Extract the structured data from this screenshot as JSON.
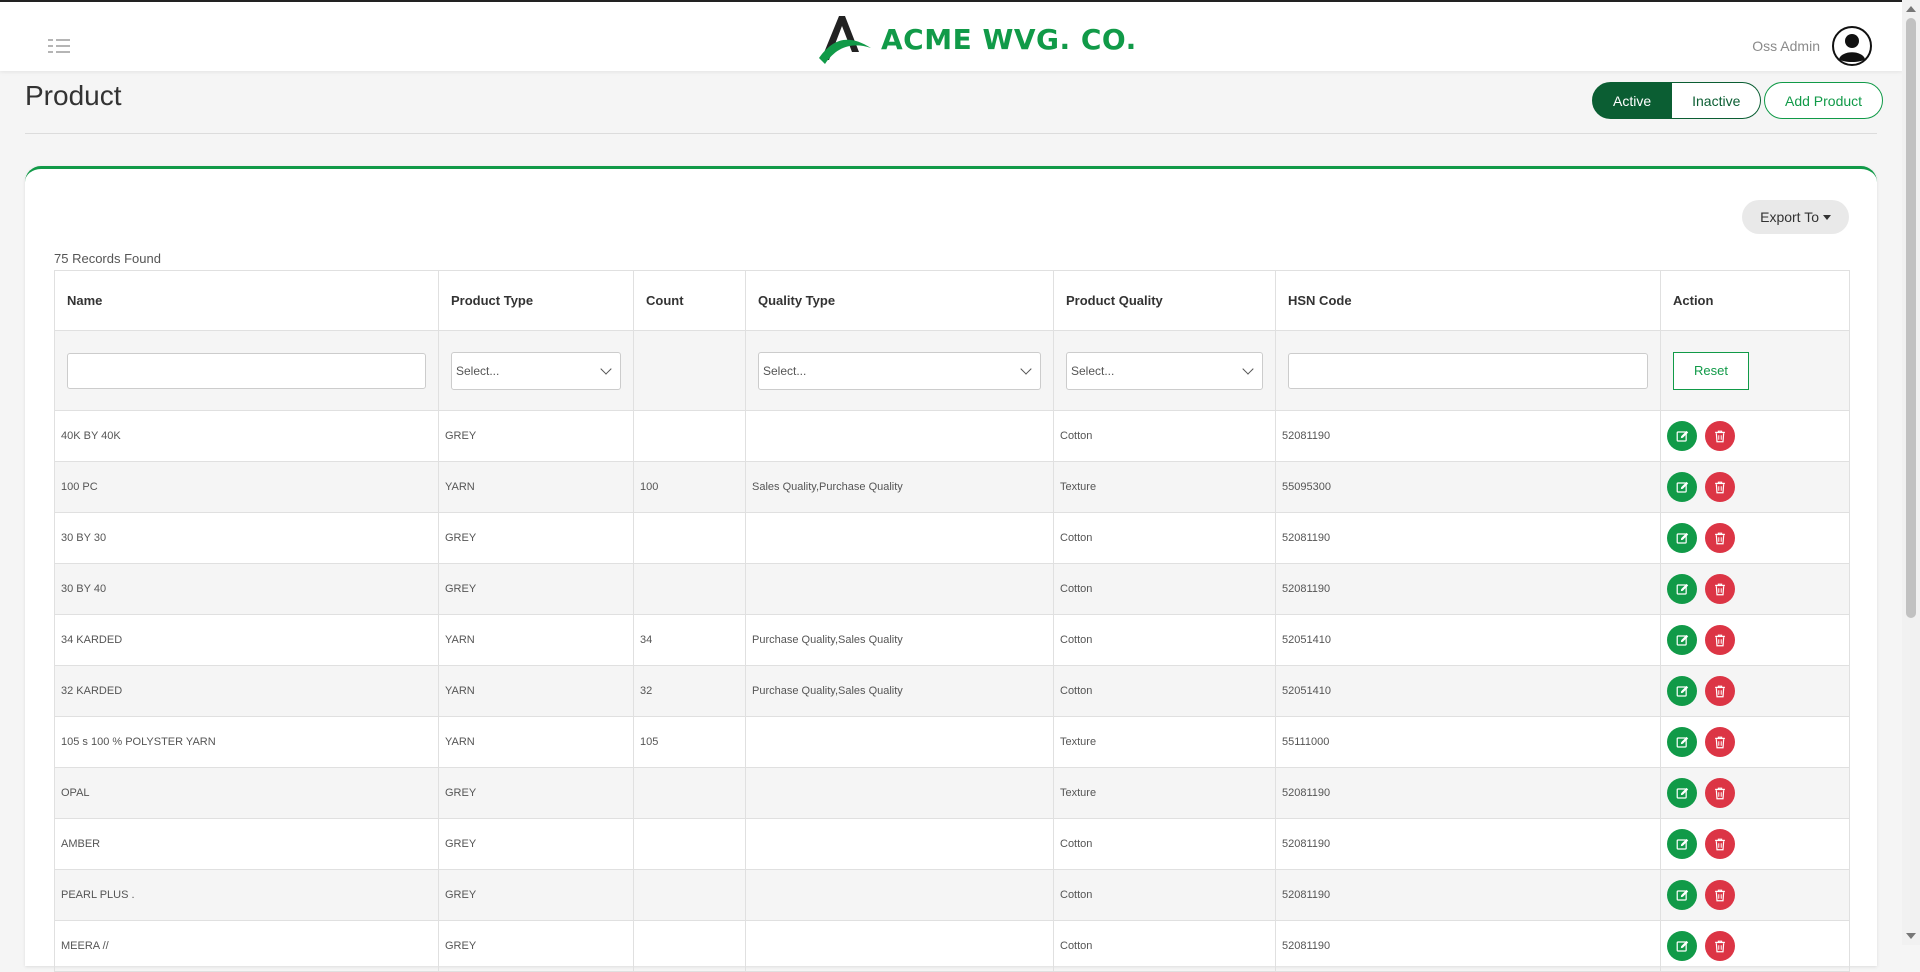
{
  "header": {
    "brand_name": "ACME WVG. CO.",
    "user_name": "Oss Admin"
  },
  "page": {
    "title": "Product",
    "status_active": "Active",
    "status_inactive": "Inactive",
    "add_button": "Add Product",
    "export_button": "Export To",
    "records_found": "75 Records Found"
  },
  "table": {
    "columns": [
      "Name",
      "Product Type",
      "Count",
      "Quality Type",
      "Product Quality",
      "HSN Code",
      "Action"
    ],
    "filters": {
      "product_type_placeholder": "Select...",
      "quality_type_placeholder": "Select...",
      "product_quality_placeholder": "Select...",
      "reset_label": "Reset"
    },
    "rows": [
      {
        "name": "40K BY 40K",
        "product_type": "GREY",
        "count": "",
        "quality_type": "",
        "product_quality": "Cotton",
        "hsn_code": "52081190"
      },
      {
        "name": "100 PC",
        "product_type": "YARN",
        "count": "100",
        "quality_type": "Sales Quality,Purchase Quality",
        "product_quality": "Texture",
        "hsn_code": "55095300"
      },
      {
        "name": "30 BY 30",
        "product_type": "GREY",
        "count": "",
        "quality_type": "",
        "product_quality": "Cotton",
        "hsn_code": "52081190"
      },
      {
        "name": "30 BY 40",
        "product_type": "GREY",
        "count": "",
        "quality_type": "",
        "product_quality": "Cotton",
        "hsn_code": "52081190"
      },
      {
        "name": "34 KARDED",
        "product_type": "YARN",
        "count": "34",
        "quality_type": "Purchase Quality,Sales Quality",
        "product_quality": "Cotton",
        "hsn_code": "52051410"
      },
      {
        "name": "32 KARDED",
        "product_type": "YARN",
        "count": "32",
        "quality_type": "Purchase Quality,Sales Quality",
        "product_quality": "Cotton",
        "hsn_code": "52051410"
      },
      {
        "name": "105 s 100 % POLYSTER YARN",
        "product_type": "YARN",
        "count": "105",
        "quality_type": "",
        "product_quality": "Texture",
        "hsn_code": "55111000"
      },
      {
        "name": "OPAL",
        "product_type": "GREY",
        "count": "",
        "quality_type": "",
        "product_quality": "Texture",
        "hsn_code": "52081190"
      },
      {
        "name": "AMBER",
        "product_type": "GREY",
        "count": "",
        "quality_type": "",
        "product_quality": "Cotton",
        "hsn_code": "52081190"
      },
      {
        "name": "PEARL PLUS .",
        "product_type": "GREY",
        "count": "",
        "quality_type": "",
        "product_quality": "Cotton",
        "hsn_code": "52081190"
      },
      {
        "name": "MEERA //",
        "product_type": "GREY",
        "count": "",
        "quality_type": "",
        "product_quality": "Cotton",
        "hsn_code": "52081190"
      }
    ]
  },
  "icons": {
    "edit": "edit-icon",
    "delete": "trash-icon",
    "menu": "menu-list-icon",
    "avatar": "user-avatar-icon"
  },
  "colors": {
    "brand_green": "#119a48",
    "dark_green": "#0b5e33",
    "danger_red": "#dc3545"
  }
}
